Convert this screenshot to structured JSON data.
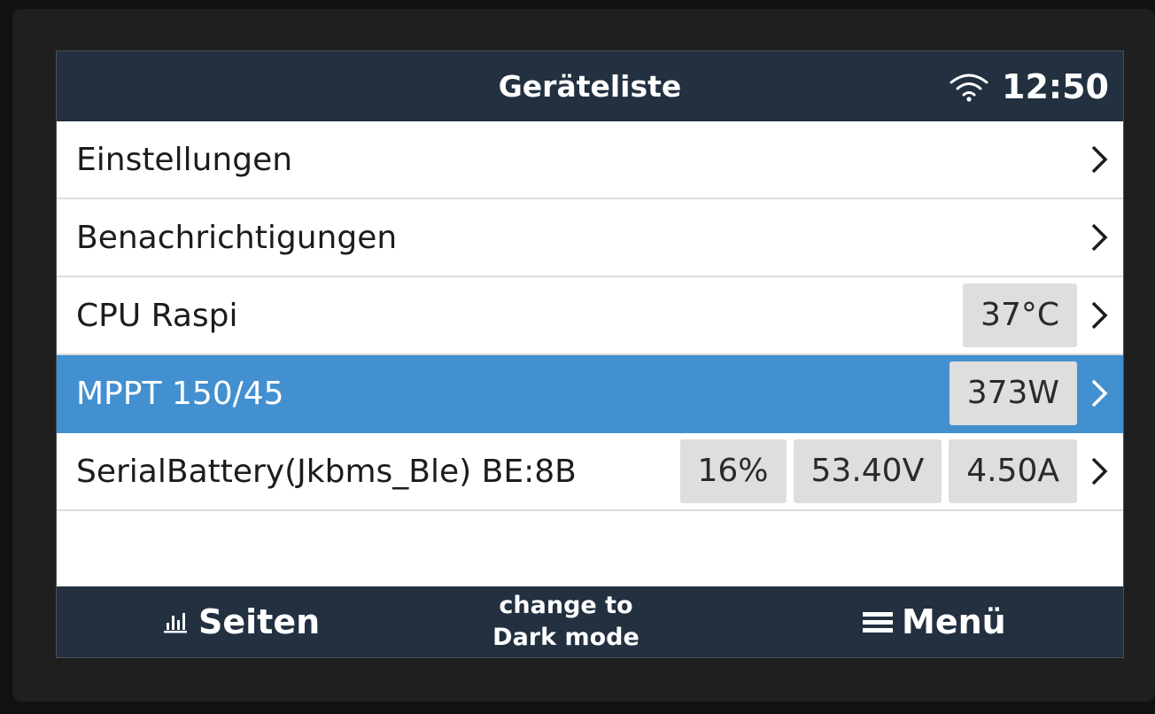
{
  "header": {
    "title": "Geräteliste",
    "time": "12:50",
    "wifi_icon": "wifi-icon"
  },
  "rows": [
    {
      "label": "Einstellungen",
      "badges": []
    },
    {
      "label": "Benachrichtigungen",
      "badges": []
    },
    {
      "label": "CPU Raspi",
      "badges": [
        "37°C"
      ]
    },
    {
      "label": "MPPT 150/45",
      "badges": [
        "373W"
      ],
      "selected": true
    },
    {
      "label": "SerialBattery(Jkbms_Ble) BE:8B",
      "badges": [
        "16%",
        "53.40V",
        "4.50A"
      ]
    }
  ],
  "footer": {
    "pages_label": "Seiten",
    "dark_mode_line1": "change to",
    "dark_mode_line2": "Dark mode",
    "menu_label": "Menü"
  },
  "colors": {
    "bar": "#223040",
    "selection": "#4390d1",
    "badge": "#dedede"
  }
}
